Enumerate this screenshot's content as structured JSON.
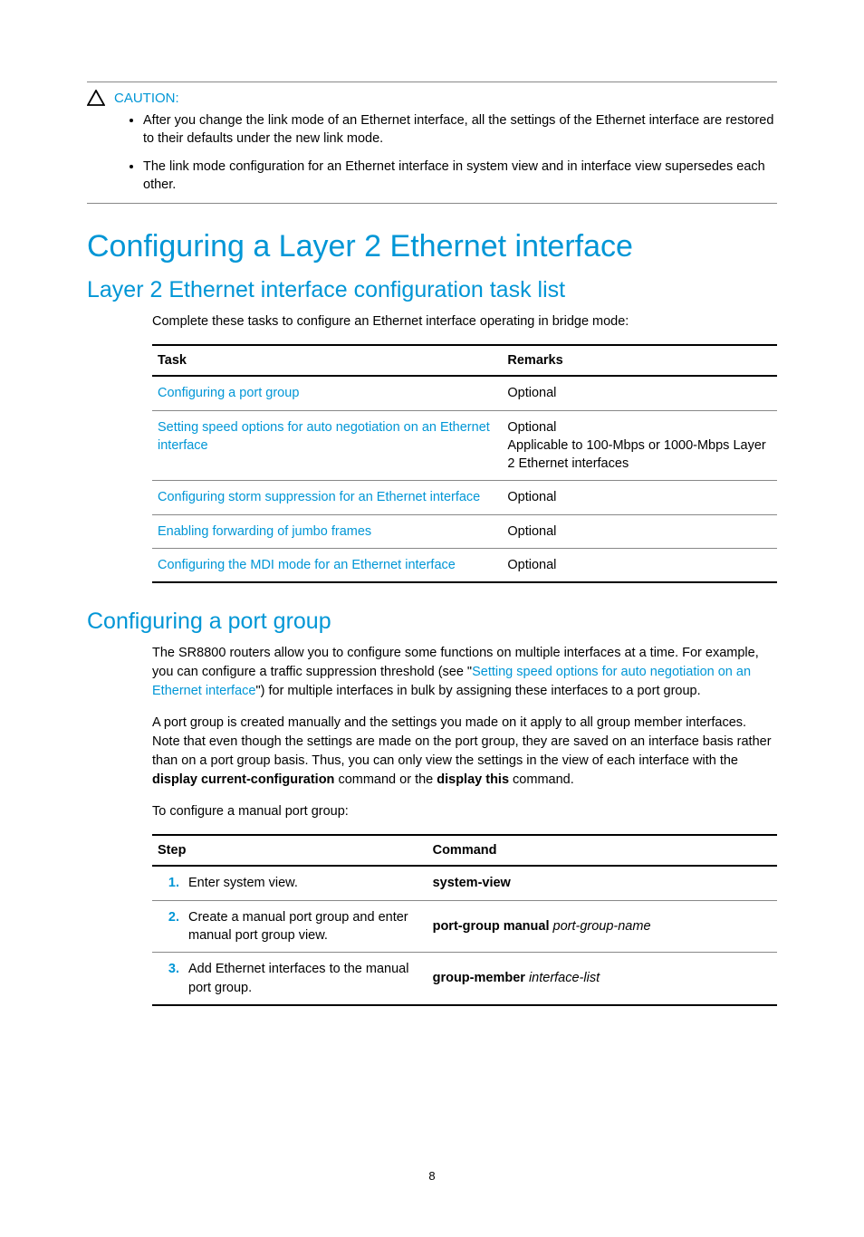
{
  "caution": {
    "label": "CAUTION:",
    "bullets": [
      "After you change the link mode of an Ethernet interface, all the settings of the Ethernet interface are restored to their defaults under the new link mode.",
      "The link mode configuration for an Ethernet interface in system view and in interface view supersedes each other."
    ]
  },
  "h1": "Configuring a Layer 2 Ethernet interface",
  "h2a": "Layer 2 Ethernet interface configuration task list",
  "intro_a": "Complete these tasks to configure an Ethernet interface operating in bridge mode:",
  "task_table": {
    "headers": {
      "task": "Task",
      "remarks": "Remarks"
    },
    "rows": [
      {
        "task": "Configuring a port group",
        "remarks": "Optional"
      },
      {
        "task": "Setting speed options for auto negotiation on an Ethernet interface",
        "remarks": "Optional\nApplicable to 100-Mbps or 1000-Mbps Layer 2 Ethernet interfaces"
      },
      {
        "task": "Configuring storm suppression for an Ethernet interface",
        "remarks": "Optional"
      },
      {
        "task": "Enabling forwarding of jumbo frames",
        "remarks": "Optional"
      },
      {
        "task": "Configuring the MDI mode for an Ethernet interface",
        "remarks": "Optional"
      }
    ]
  },
  "h2b": "Configuring a port group",
  "pg_para1_pre": "The SR8800 routers allow you to configure some functions on multiple interfaces at a time. For example, you can configure a traffic suppression threshold (see \"",
  "pg_para1_link": "Setting speed options for auto negotiation on an Ethernet interface",
  "pg_para1_post": "\") for multiple interfaces in bulk by assigning these interfaces to a port group.",
  "pg_para2_pre": "A port group is created manually and the settings you made on it apply to all group member interfaces. Note that even though the settings are made on the port group, they are saved on an interface basis rather than on a port group basis. Thus, you can only view the settings in the view of each interface with the ",
  "pg_para2_bold1": "display current-configuration",
  "pg_para2_mid": " command or the ",
  "pg_para2_bold2": "display this",
  "pg_para2_end": " command.",
  "pg_para3": "To configure a manual port group:",
  "step_table": {
    "headers": {
      "step": "Step",
      "command": "Command"
    },
    "rows": [
      {
        "num": "1.",
        "step": "Enter system view.",
        "cmd_bold": "system-view",
        "cmd_ital": ""
      },
      {
        "num": "2.",
        "step": "Create a manual port group and enter manual port group view.",
        "cmd_bold": "port-group manual ",
        "cmd_ital": "port-group-name"
      },
      {
        "num": "3.",
        "step": "Add Ethernet interfaces to the manual port group.",
        "cmd_bold": "group-member ",
        "cmd_ital": "interface-list"
      }
    ]
  },
  "pagenum": "8"
}
